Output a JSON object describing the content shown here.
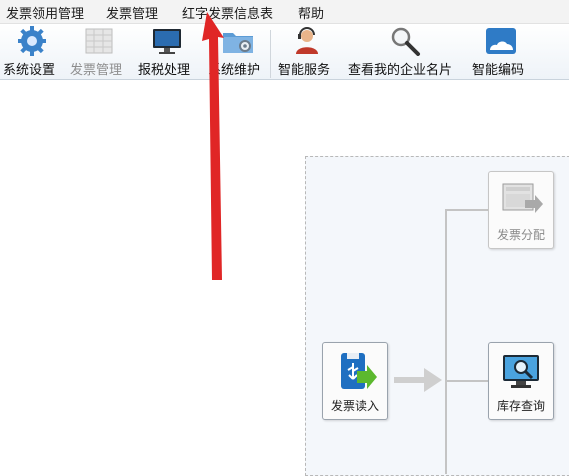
{
  "menu": {
    "items": [
      {
        "label": "发票领用管理"
      },
      {
        "label": "发票管理"
      },
      {
        "label": "红字发票信息表"
      },
      {
        "label": "帮助"
      }
    ]
  },
  "toolbar": {
    "buttons": [
      {
        "label": "系统设置",
        "icon": "gear-icon",
        "enabled": true
      },
      {
        "label": "发票管理",
        "icon": "invoice-grid-icon",
        "enabled": false
      },
      {
        "label": "报税处理",
        "icon": "monitor-icon",
        "enabled": true
      },
      {
        "label": "系统维护",
        "icon": "folder-gear-icon",
        "enabled": true
      },
      {
        "label": "智能服务",
        "icon": "support-agent-icon",
        "enabled": true
      },
      {
        "label": "查看我的企业名片",
        "icon": "magnifier-icon",
        "enabled": true
      },
      {
        "label": "智能编码",
        "icon": "cloud-icon",
        "enabled": true
      }
    ]
  },
  "flow": {
    "tiles": [
      {
        "label": "发票分配",
        "icon": "invoice-distribute-icon",
        "enabled": false
      },
      {
        "label": "发票读入",
        "icon": "usb-import-icon",
        "enabled": true
      },
      {
        "label": "库存查询",
        "icon": "inventory-search-icon",
        "enabled": true
      }
    ]
  },
  "colors": {
    "annotation_arrow": "#e02626",
    "connector": "#c4c4c4",
    "panel_bg": "#f4f7fb"
  }
}
